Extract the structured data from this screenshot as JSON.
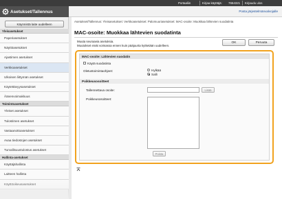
{
  "topbar": {
    "portal_label": "Portaaliin",
    "logout_label": "Kirjaa käyttäjä:",
    "user_id": "7654321",
    "logout_action": "Kirjaudu ulos"
  },
  "header": {
    "app_title": "Asetukset/Tallennus",
    "admin_link": "Posta järjestelmänvalvojalle"
  },
  "sidebar": {
    "start_button": "Käynnistä laite uudelleen",
    "sections": [
      {
        "title": "Yleisasetukset",
        "items": [
          "Paperiasetukset",
          "Näyttöasetukset",
          "Ajastimen asetukset",
          "Verkkoasetukset",
          "Ulkoisen liittymän asetukset",
          "Käytettävyysasetukset",
          "Äänenvoimakkuus"
        ]
      },
      {
        "title": "Toimintoasetukset",
        "items": [
          "Yleiset asetukset",
          "Tulostimen asetukset",
          "Vastaanottoasetukset",
          "Avaa tiedostojen asetukset",
          "Turvallisuustulostus asetukset"
        ]
      },
      {
        "title": "Hallinta-asetukset",
        "items": [
          "Käyttäjähallinta",
          "Laitteen hallinta",
          "Käyttöoikeusasetukset"
        ]
      }
    ],
    "active_item": "Verkkoasetukset"
  },
  "main": {
    "breadcrumb": "Asetukset/Tallennus: Yleisasetukset: Verkkoasetukset: Palomuuriasetukset: MAC-osoite: Muokkaa lähtevien suodatinta",
    "page_title": "MAC-osoite: Muokkaa lähtevien suodatinta",
    "message_1": "Muuta seuraavia asetuksia.",
    "message_2": "Muutokset eivät voimassa ennen kuin pääjuurta kytketään uudelleen.",
    "ok_button": "OK",
    "cancel_button": "Peruuta",
    "filter_section_title": "MAC-osoite: Lähtevien suodatin",
    "use_filter_label": "Käytä suodatinta",
    "default_policy_label": "Oletustoimintaohjeet:",
    "policy_options": [
      "Hylkää",
      "Salli"
    ],
    "policy_selected": "Salli",
    "exceptions_section_title": "Poikkeusosoitteet",
    "address_label": "Tallennettava osoite:",
    "add_button": "Lisää",
    "exception_list_label": "Poikkeusosoitteet:",
    "delete_button": "Poista"
  },
  "icons": {
    "gear": "gear-icon",
    "top": "back-to-top-icon"
  },
  "colors": {
    "highlight": "#f1a21d",
    "header_dark": "#505050",
    "topbar": "#3c3c3c",
    "link": "#1a4f9c"
  }
}
